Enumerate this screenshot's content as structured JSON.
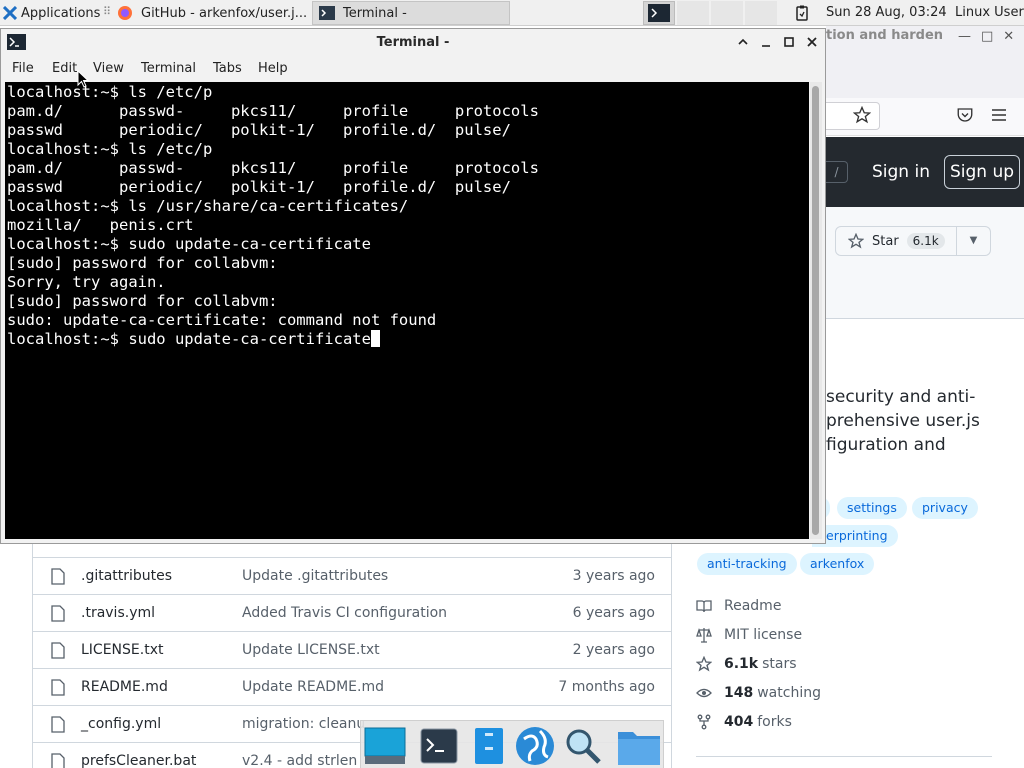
{
  "panel": {
    "applications_label": "Applications",
    "tasks": [
      {
        "label": "GitHub - arkenfox/user.j..."
      },
      {
        "label": "Terminal -"
      }
    ],
    "clock": "Sun 28 Aug, 03:24",
    "user": "Linux User"
  },
  "terminal": {
    "title": "Terminal -",
    "menu": [
      "File",
      "Edit",
      "View",
      "Terminal",
      "Tabs",
      "Help"
    ],
    "lines": [
      "localhost:~$ ls /etc/p",
      "pam.d/      passwd-     pkcs11/     profile     protocols",
      "passwd      periodic/   polkit-1/   profile.d/  pulse/",
      "localhost:~$ ls /etc/p",
      "pam.d/      passwd-     pkcs11/     profile     protocols",
      "passwd      periodic/   polkit-1/   profile.d/  pulse/",
      "localhost:~$ ls /usr/share/ca-certificates/",
      "mozilla/   penis.crt",
      "localhost:~$ sudo update-ca-certificate",
      "[sudo] password for collabvm:",
      "Sorry, try again.",
      "[sudo] password for collabvm:",
      "sudo: update-ca-certificate: command not found"
    ],
    "prompt_line": "localhost:~$ sudo update-ca-certificate"
  },
  "firefox": {
    "title_fragment": "tion and harden",
    "header": {
      "sign_in": "Sign in",
      "sign_up": "Sign up",
      "slash": "/"
    },
    "star": {
      "label": "Star",
      "count": "6.1k"
    },
    "about_lines": [
      "security and anti-",
      "prehensive user.js",
      "figuration and"
    ],
    "topics": [
      "settings",
      "privacy",
      "erprinting",
      "anti-tracking",
      "arkenfox"
    ],
    "meta": [
      {
        "icon": "book-icon",
        "text": "Readme",
        "bold": ""
      },
      {
        "icon": "law-icon",
        "text": "MIT license",
        "bold": ""
      },
      {
        "icon": "star-icon",
        "text": "stars",
        "bold": "6.1k"
      },
      {
        "icon": "eye-icon",
        "text": "watching",
        "bold": "148"
      },
      {
        "icon": "fork-icon",
        "text": "forks",
        "bold": "404"
      }
    ],
    "files": [
      {
        "name": ".gitattributes",
        "message": "Update .gitattributes",
        "age": "3 years ago"
      },
      {
        "name": ".travis.yml",
        "message": "Added Travis CI configuration",
        "age": "6 years ago"
      },
      {
        "name": "LICENSE.txt",
        "message": "Update LICENSE.txt",
        "age": "2 years ago"
      },
      {
        "name": "README.md",
        "message": "Update README.md",
        "age": "7 months ago"
      },
      {
        "name": "_config.yml",
        "message": "migration: cleanu",
        "age": ""
      },
      {
        "name": "prefsCleaner.bat",
        "message": "v2.4 - add strlen",
        "age": ""
      }
    ]
  },
  "dock": [
    "show-desktop-icon",
    "terminal-icon",
    "file-manager-icon",
    "web-browser-icon",
    "search-icon",
    "folder-icon"
  ]
}
